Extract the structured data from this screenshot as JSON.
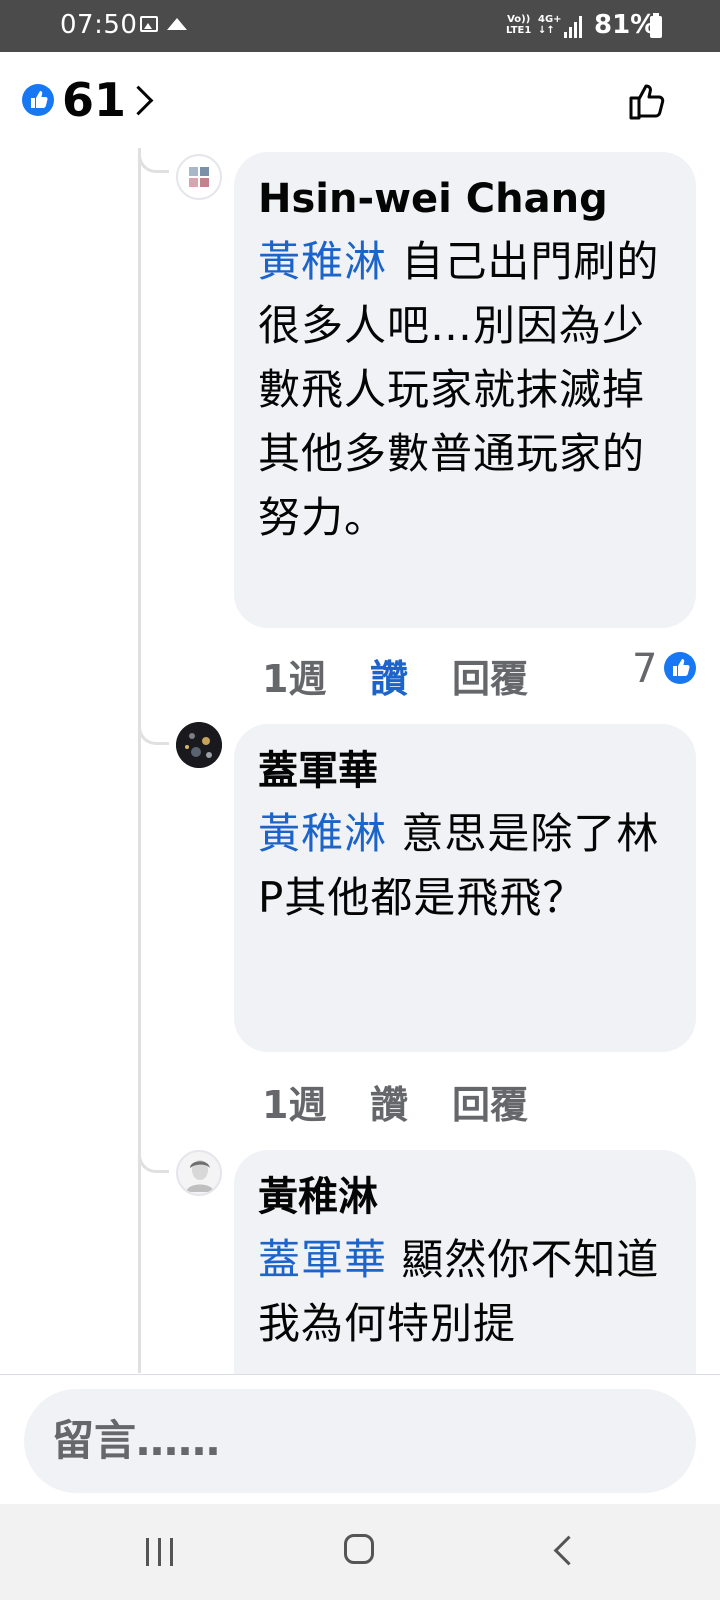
{
  "status_bar": {
    "time": "07:50",
    "volte_label": "Vo))\nLTE1",
    "network_label": "4G+\n↓↑",
    "battery": "81%"
  },
  "header": {
    "reaction_count": "61",
    "reaction_icon": "thumbs-up-badge",
    "like_icon": "thumbs-up-outline"
  },
  "comments": [
    {
      "author": "Hsin-wei Chang",
      "mention": "黃稚淋",
      "text": " 自己出門刷的很多人吧…別因為少數飛人玩家就抹滅掉其他多數普通玩家的努力。",
      "time": "1週",
      "like_label": "讚",
      "reply_label": "回覆",
      "likes": "7",
      "liked": true
    },
    {
      "author": "蓋軍華",
      "mention": "黃稚淋",
      "text": " 意思是除了林P其他都是飛飛？",
      "time": "1週",
      "like_label": "讚",
      "reply_label": "回覆",
      "liked": false
    },
    {
      "author": "黃稚淋",
      "mention": "蓋軍華",
      "text": " 顯然你不知道我為何特別提"
    }
  ],
  "composer": {
    "placeholder": "留言……"
  },
  "colors": {
    "facebook_blue": "#1877f2",
    "mention_blue": "#1c64c9",
    "bubble_bg": "#f0f2f5",
    "meta_gray": "#65676b"
  }
}
